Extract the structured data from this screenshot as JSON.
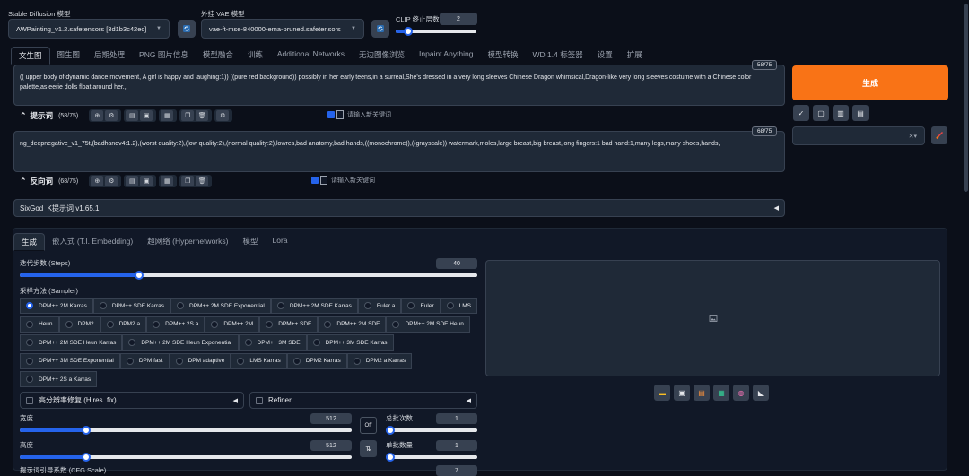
{
  "header": {
    "sd_model_label": "Stable Diffusion 模型",
    "sd_model_value": "AWPainting_v1.2.safetensors [3d1b3c42ec]",
    "vae_label": "外挂 VAE 模型",
    "vae_value": "vae-ft-mse-840000-ema-pruned.safetensors",
    "clip_label": "CLIP 终止层数",
    "clip_value": "2"
  },
  "tabs": [
    "文生图",
    "图生图",
    "后期处理",
    "PNG 图片信息",
    "模型融合",
    "训练",
    "Additional Networks",
    "无边图像浏览",
    "Inpaint Anything",
    "模型转换",
    "WD 1.4 标签器",
    "设置",
    "扩展"
  ],
  "prompt": {
    "text": "(( upper body of dynamic dance movement, A girl is happy and laughing:1)) ((pure red background))  possibly in her early teens,in a surreal,She's dressed in a very long sleeves Chinese Dragon whimsical,Dragon-like very long sleeves costume with a Chinese color palette,as eerie dolls float around her.,",
    "counter": "58/75",
    "label": "提示词",
    "label_count": "(58/75)",
    "keyword_placeholder": "请输入新关键词"
  },
  "negative": {
    "text": "ng_deepnegative_v1_75t,(badhandv4:1.2),(worst quality:2),(low quality:2),(normal quality:2),lowres,bad anatomy,bad hands,((monochrome)),((grayscale)) watermark,moles,large breast,big breast,long fingers:1 bad hand:1,many legs,many shoes,hands,",
    "counter": "68/75",
    "label": "反向词",
    "label_count": "(68/75)",
    "keyword_placeholder": "请输入新关键词"
  },
  "generate_label": "生成",
  "sixgod_label": "SixGod_K提示词 v1.65.1",
  "subtabs": [
    "生成",
    "嵌入式 (T.I. Embedding)",
    "超网络 (Hypernetworks)",
    "模型",
    "Lora"
  ],
  "steps": {
    "label": "迭代步数 (Steps)",
    "value": 40,
    "min": 1,
    "max": 150
  },
  "sampler": {
    "label": "采样方法 (Sampler)",
    "selected": "DPM++ 2M Karras",
    "rows": [
      [
        "DPM++ 2M Karras",
        "DPM++ SDE Karras",
        "DPM++ 2M SDE Exponential",
        "DPM++ 2M SDE Karras",
        "Euler a",
        "Euler",
        "LMS"
      ],
      [
        "Heun",
        "DPM2",
        "DPM2 a",
        "DPM++ 2S a",
        "DPM++ 2M",
        "DPM++ SDE",
        "DPM++ 2M SDE",
        "DPM++ 2M SDE Heun"
      ],
      [
        "DPM++ 2M SDE Heun Karras",
        "DPM++ 2M SDE Heun Exponential",
        "DPM++ 3M SDE",
        "DPM++ 3M SDE Karras"
      ],
      [
        "DPM++ 3M SDE Exponential",
        "DPM fast",
        "DPM adaptive",
        "LMS Karras",
        "DPM2 Karras",
        "DPM2 a Karras"
      ],
      [
        "DPM++ 2S a Karras"
      ]
    ]
  },
  "hires_label": "高分辨率修复 (Hires. fix)",
  "refiner_label": "Refiner",
  "width": {
    "label": "宽度",
    "value": "512",
    "fraction": 0.2
  },
  "height": {
    "label": "高度",
    "value": "512",
    "fraction": 0.2
  },
  "batch_count": {
    "label": "总批次数",
    "value": "1",
    "fraction": 0.0
  },
  "batch_size": {
    "label": "单批数量",
    "value": "1",
    "fraction": 0.0
  },
  "off_label": "Off",
  "cfg_label": "提示词引导系数 (CFG Scale)",
  "cfg_value": "7"
}
